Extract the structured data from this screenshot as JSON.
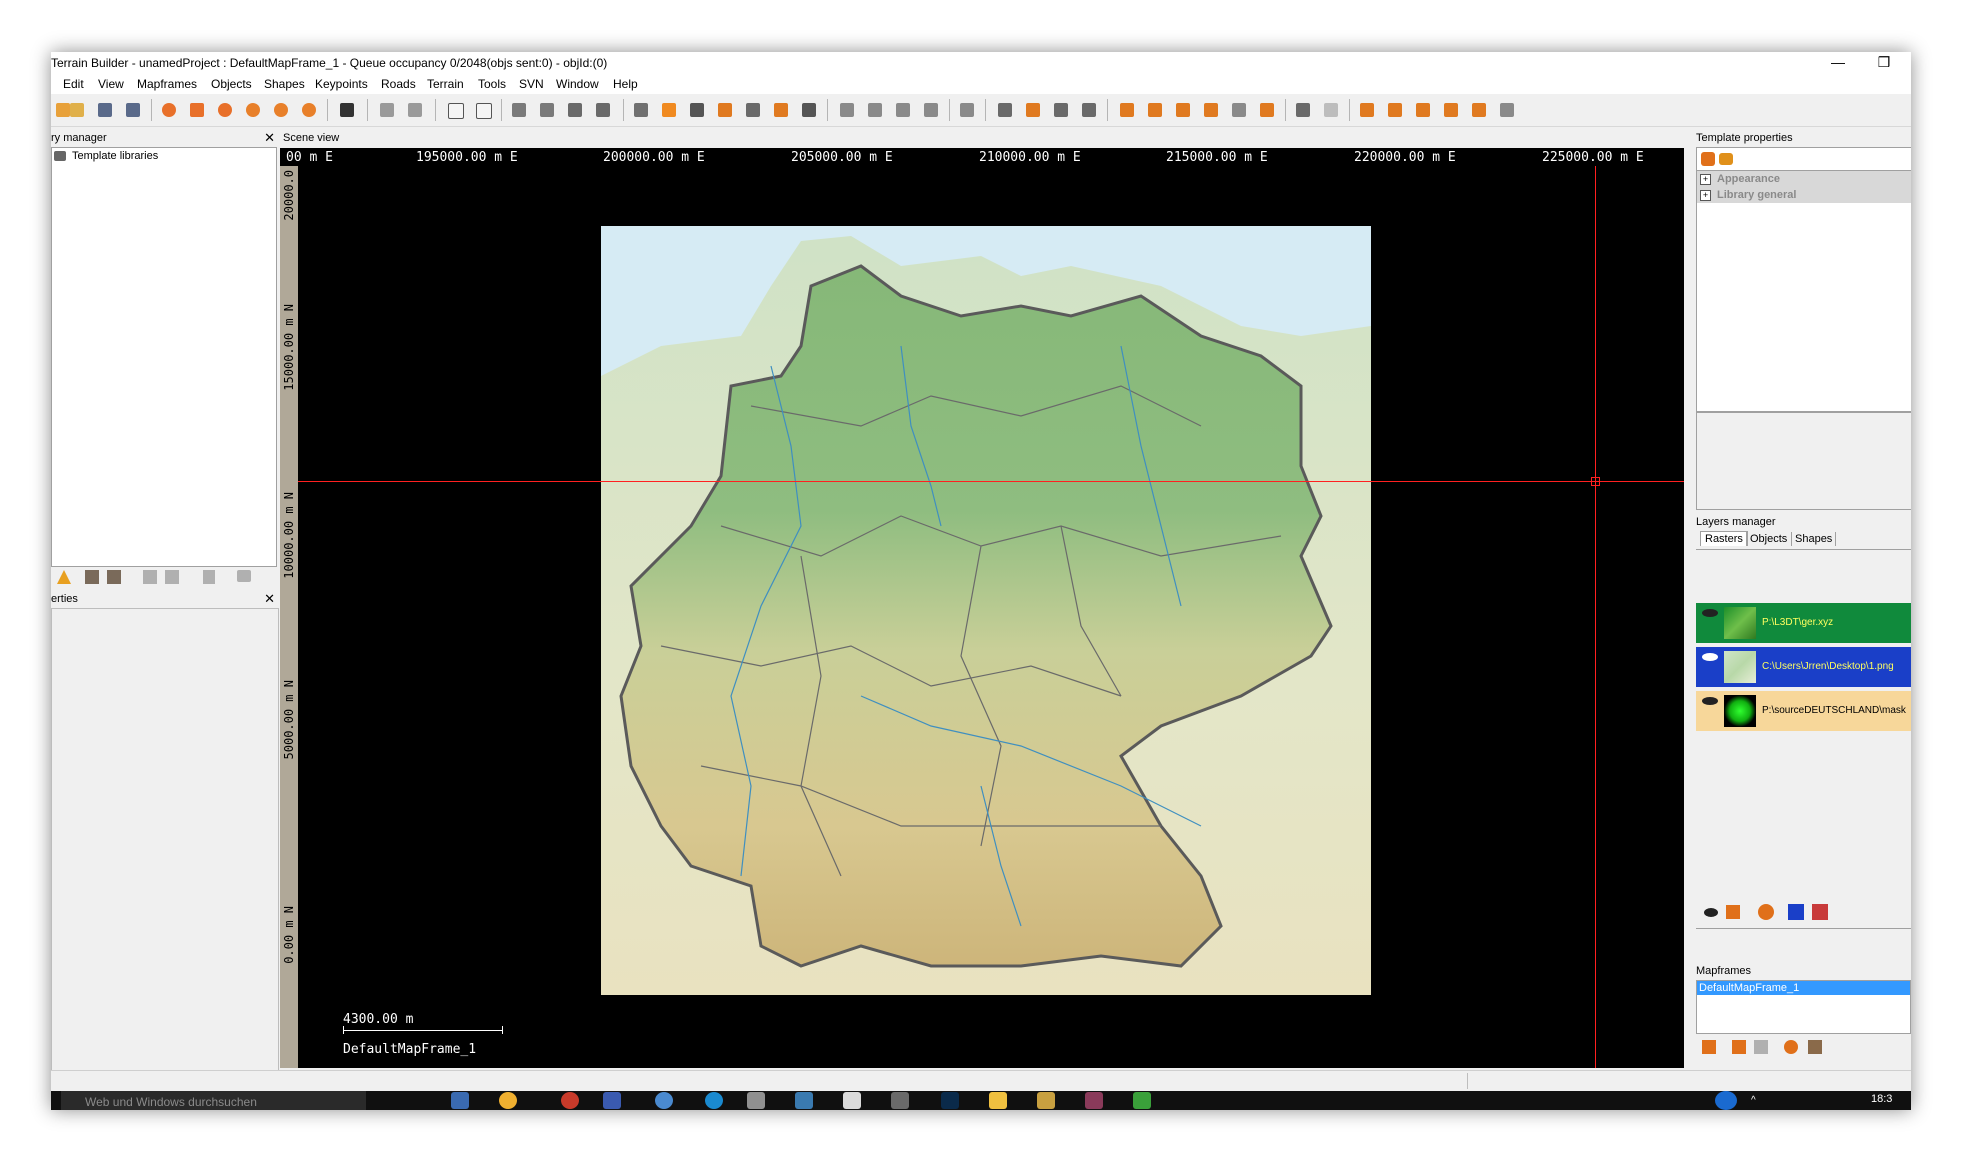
{
  "window": {
    "title": "Terrain Builder - unamedProject : DefaultMapFrame_1 - Queue occupancy 0/2048(objs sent:0) - objId:(0)",
    "minimize_glyph": "—",
    "restore_glyph": "❒"
  },
  "menu": [
    "Edit",
    "View",
    "Mapframes",
    "Objects",
    "Shapes",
    "Keypoints",
    "Roads",
    "Terrain",
    "Tools",
    "SVN",
    "Window",
    "Help"
  ],
  "library_manager": {
    "title": "ry manager",
    "close": "✕",
    "tree_root": "Template libraries"
  },
  "properties_panel": {
    "title": "erties",
    "close": "✕"
  },
  "scene_view": {
    "title": "Scene view",
    "close": "✕",
    "top_ruler": [
      "00 m E",
      "195000.00 m E",
      "200000.00 m E",
      "205000.00 m E",
      "210000.00 m E",
      "215000.00 m E",
      "220000.00 m E",
      "225000.00 m E"
    ],
    "left_ruler": [
      "20000.0",
      "15000.00 m N",
      "10000.00 m N",
      "5000.00 m N",
      "0.00 m N"
    ],
    "scale_label": "4300.00 m",
    "mapframe_label": "DefaultMapFrame_1"
  },
  "template_properties": {
    "title": "Template properties",
    "items": [
      "Appearance",
      "Library general"
    ]
  },
  "layers_manager": {
    "title": "Layers manager",
    "tabs": [
      "Rasters",
      "Objects",
      "Shapes"
    ],
    "layers": [
      {
        "path": "P:\\L3DT\\ger.xyz",
        "bg": "#108a3c"
      },
      {
        "path": "C:\\Users\\Jrren\\Desktop\\1.png",
        "bg": "#1a3fc8"
      },
      {
        "path": "P:\\sourceDEUTSCHLAND\\mask",
        "bg": "#f7d79a"
      }
    ]
  },
  "mapframes": {
    "title": "Mapframes",
    "items": [
      "DefaultMapFrame_1"
    ]
  },
  "taskbar": {
    "search_placeholder": "Web und Windows durchsuchen",
    "clock": "18:3"
  },
  "colors": {
    "accent_blue": "#3399ff",
    "layer_green": "#108a3c",
    "layer_blue": "#1a3fc8",
    "layer_orange": "#f7d79a",
    "crosshair": "#ff2020"
  }
}
